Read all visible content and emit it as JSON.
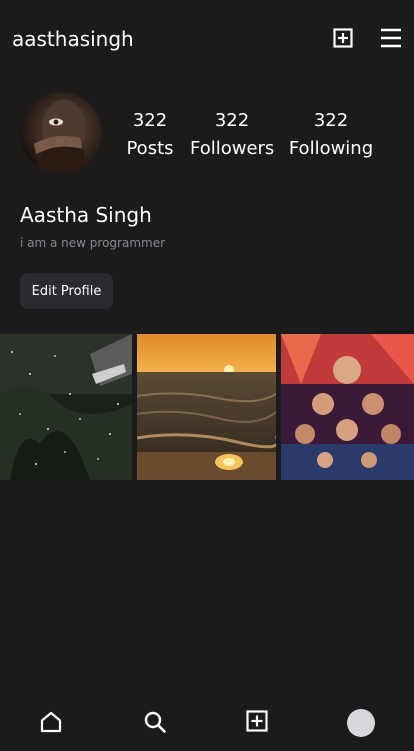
{
  "header": {
    "username": "aasthasingh",
    "add_icon": "plus-square-icon",
    "menu_icon": "hamburger-menu-icon"
  },
  "profile": {
    "stats": [
      {
        "value": "322",
        "label": "Posts"
      },
      {
        "value": "322",
        "label": "Followers"
      },
      {
        "value": "322",
        "label": "Following"
      }
    ],
    "full_name": "Aastha Singh",
    "bio": "i am a new programmer",
    "edit_label": "Edit Profile"
  },
  "posts": [
    {
      "subject": "rainy window with trees"
    },
    {
      "subject": "sunset over the sea"
    },
    {
      "subject": "colourful movie poster"
    }
  ],
  "nav": {
    "icons": [
      "home-icon",
      "search-icon",
      "plus-square-icon",
      "profile-avatar"
    ]
  },
  "colors": {
    "background": "#1b1b1d",
    "button": "#2b2b2f",
    "muted_text": "#8a8a8e"
  }
}
